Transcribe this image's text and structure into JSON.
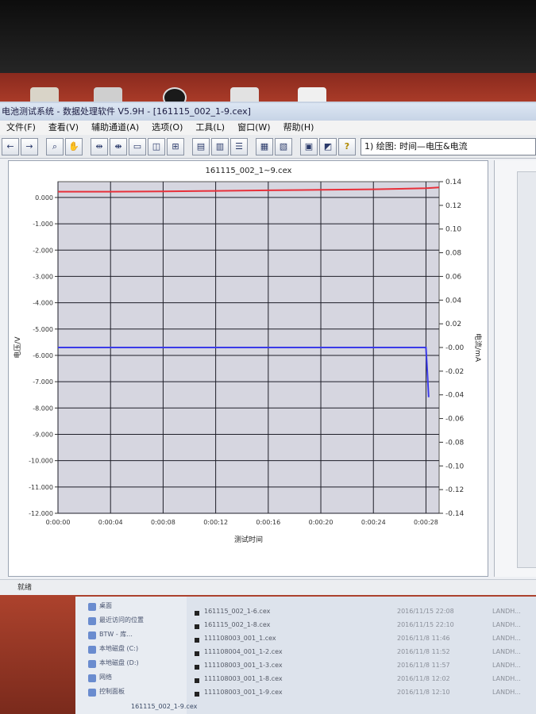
{
  "window": {
    "title": "电池测试系统 - 数据处理软件 V5.9H - [161115_002_1-9.cex]"
  },
  "menu": [
    {
      "label": "文件(F)"
    },
    {
      "label": "查看(V)"
    },
    {
      "label": "辅助通道(A)"
    },
    {
      "label": "选项(O)"
    },
    {
      "label": "工具(L)"
    },
    {
      "label": "窗口(W)"
    },
    {
      "label": "帮助(H)"
    }
  ],
  "toolbar": {
    "plot_select_value": "1) 绘图: 时间—电压&电流"
  },
  "status_bar": {
    "text": "就绪"
  },
  "chart_data": {
    "type": "line",
    "title": "161115_002_1~9.cex",
    "xlabel": "测试时间",
    "ylabel": "电压/V",
    "y2label": "电流/mA",
    "x_ticks": [
      "0:00:00",
      "0:00:04",
      "0:00:08",
      "0:00:12",
      "0:00:16",
      "0:00:20",
      "0:00:24",
      "0:00:28"
    ],
    "y_ticks": [
      "0.000",
      "-1.000",
      "-2.000",
      "-3.000",
      "-4.000",
      "-5.000",
      "-6.000",
      "-7.000",
      "-8.000",
      "-9.000",
      "-10.000",
      "-11.000",
      "-12.000"
    ],
    "y2_ticks": [
      "0.14",
      "0.12",
      "0.10",
      "0.08",
      "0.06",
      "0.04",
      "0.02",
      "-0.00",
      "-0.02",
      "-0.04",
      "-0.06",
      "-0.08",
      "-0.10",
      "-0.12",
      "-0.14"
    ],
    "ylim": [
      -12,
      0.6
    ],
    "y2lim": [
      -0.14,
      0.14
    ],
    "xlim": [
      0,
      29
    ],
    "grid": true,
    "series": [
      {
        "axis": "left",
        "color": "#e8303a",
        "x": [
          0,
          4,
          8,
          12,
          16,
          20,
          24,
          28,
          29
        ],
        "y": [
          0.22,
          0.22,
          0.23,
          0.25,
          0.27,
          0.29,
          0.31,
          0.35,
          0.38
        ]
      },
      {
        "axis": "right",
        "color": "#3a3ae8",
        "x": [
          0,
          4,
          8,
          12,
          16,
          20,
          24,
          28,
          28.1,
          28.2
        ],
        "y": [
          0.0,
          0.0,
          0.0,
          0.0,
          0.0,
          0.0,
          0.0,
          0.0,
          -0.02,
          -0.042
        ]
      }
    ],
    "colors": {
      "plot_background": "#d6d6e0",
      "grid": "#1e1e28"
    }
  },
  "explorer": {
    "nav_items": [
      {
        "label": "桌面"
      },
      {
        "label": "最近访问的位置"
      },
      {
        "label": "BTW - 库..."
      },
      {
        "label": "本地磁盘 (C:)"
      },
      {
        "label": "本地磁盘 (D:)"
      },
      {
        "label": "网络"
      },
      {
        "label": "控制面板"
      }
    ],
    "files": [
      {
        "name": "161115_002_1-6.cex",
        "date": "2016/11/15 22:08",
        "extra": "LANDH..."
      },
      {
        "name": "161115_002_1-8.cex",
        "date": "2016/11/15 22:10",
        "extra": "LANDH..."
      },
      {
        "name": "111108003_001_1.cex",
        "date": "2016/11/8 11:46",
        "extra": "LANDH..."
      },
      {
        "name": "111108004_001_1-2.cex",
        "date": "2016/11/8 11:52",
        "extra": "LANDH..."
      },
      {
        "name": "111108003_001_1-3.cex",
        "date": "2016/11/8 11:57",
        "extra": "LANDH..."
      },
      {
        "name": "111108003_001_1-8.cex",
        "date": "2016/11/8 12:02",
        "extra": "LANDH..."
      },
      {
        "name": "111108003_001_1-9.cex",
        "date": "2016/11/8 12:10",
        "extra": "LANDH..."
      }
    ],
    "selected_file": "161115_002_1-9.cex"
  }
}
